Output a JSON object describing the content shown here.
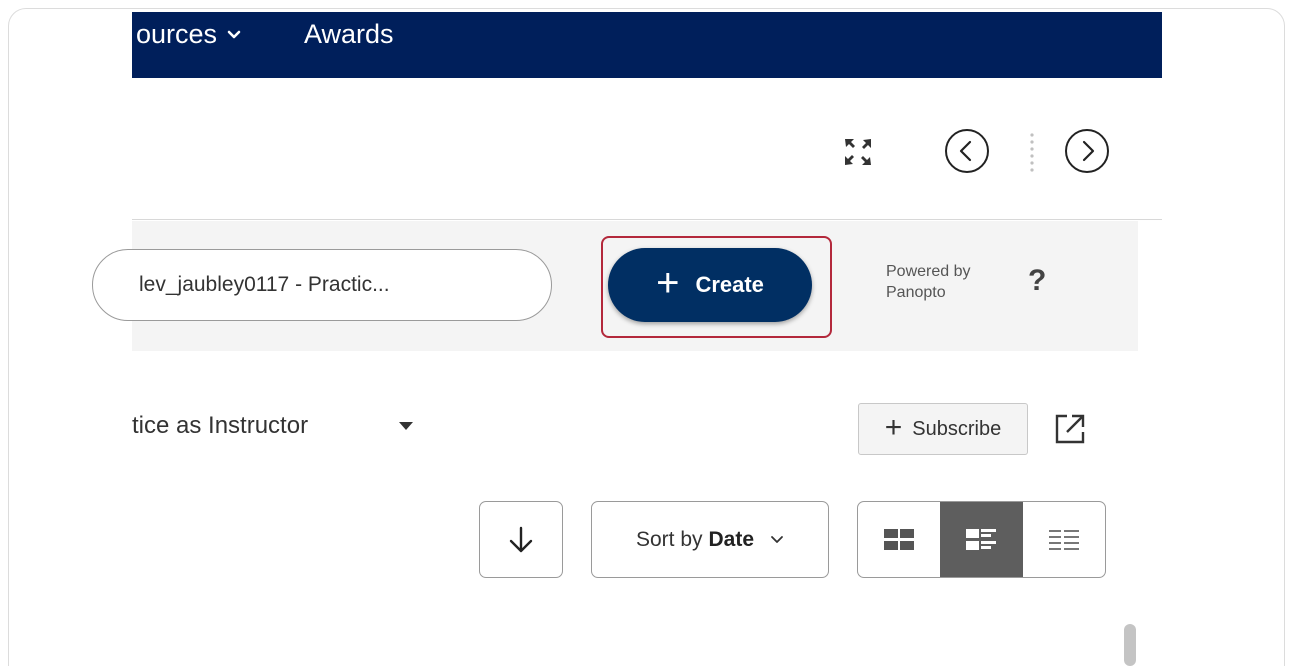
{
  "topnav": {
    "items": [
      {
        "label": "ources",
        "has_dropdown": true
      },
      {
        "label": "Awards",
        "has_dropdown": false
      }
    ],
    "background": "#001f5b"
  },
  "toolbar": {
    "expand_icon": "fullscreen-icon",
    "prev_icon": "chevron-left-circle-icon",
    "next_icon": "chevron-right-circle-icon"
  },
  "panopto": {
    "folder_select_value": "lev_jaubley0117 - Practic...",
    "create_label": "Create",
    "create_icon": "plus-icon",
    "create_color": "#012f63",
    "highlight_color": "#b3283b",
    "powered_by_line1": "Powered by",
    "powered_by_line2": "Panopto",
    "help_label": "?"
  },
  "folder": {
    "title": "tice as Instructor",
    "subscribe_label": "Subscribe",
    "open_new_icon": "open-in-new-icon"
  },
  "sort": {
    "direction_icon": "arrow-down-icon",
    "prefix": "Sort by",
    "value": "Date"
  },
  "views": {
    "options": [
      "thumbnail-view-icon",
      "detail-view-icon",
      "list-view-icon"
    ],
    "active_index": 1
  }
}
